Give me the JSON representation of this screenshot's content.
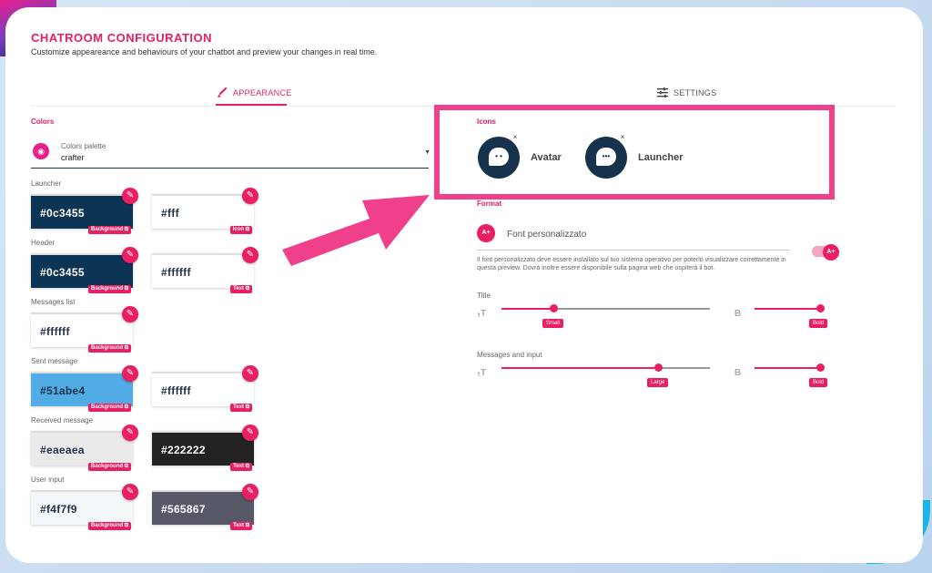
{
  "header": {
    "title": "CHATROOM CONFIGURATION",
    "subtitle": "Customize appeareance and behaviours of your chatbot and preview your changes in real time."
  },
  "tabs": [
    {
      "label": "APPEARANCE",
      "active": true
    },
    {
      "label": "SETTINGS",
      "active": false
    }
  ],
  "colors": {
    "section_label": "Colors",
    "palette": {
      "label": "Colors palette",
      "value": "crafter"
    },
    "groups": [
      {
        "label": "Launcher",
        "swatches": [
          {
            "hex": "#0c3455",
            "tag": "Background"
          },
          {
            "hex": "#fff",
            "tag": "Icon"
          }
        ]
      },
      {
        "label": "Header",
        "swatches": [
          {
            "hex": "#0c3455",
            "tag": "Background"
          },
          {
            "hex": "#ffffff",
            "tag": "Text"
          }
        ]
      },
      {
        "label": "Messages list",
        "swatches": [
          {
            "hex": "#ffffff",
            "tag": "Background"
          }
        ]
      },
      {
        "label": "Sent message",
        "swatches": [
          {
            "hex": "#51abe4",
            "tag": "Background"
          },
          {
            "hex": "#ffffff",
            "tag": "Text"
          }
        ]
      },
      {
        "label": "Received message",
        "swatches": [
          {
            "hex": "#eaeaea",
            "tag": "Background"
          },
          {
            "hex": "#222222",
            "tag": "Text"
          }
        ]
      },
      {
        "label": "User input",
        "swatches": [
          {
            "hex": "#f4f7f9",
            "tag": "Background"
          },
          {
            "hex": "#565867",
            "tag": "Text"
          }
        ]
      }
    ]
  },
  "icons": {
    "section_label": "Icons",
    "items": [
      {
        "label": "Avatar",
        "icon": "bot-face-icon"
      },
      {
        "label": "Launcher",
        "icon": "chat-dots-icon"
      }
    ]
  },
  "format": {
    "section_label": "Format",
    "custom_font": {
      "label": "Font personalizzato",
      "description": "Il font personalizzato deve essere installato sul tuo sistema operativo per poterlo visualizzare correttamente in questa preview. Dovrà inoltre essere disponibile sulla pagina web che ospiterà il bot.",
      "enabled": true
    },
    "title": {
      "label": "Title",
      "size": {
        "value": "Small",
        "level": 0.25
      },
      "weight": {
        "value": "Bold",
        "level": 1.0
      }
    },
    "messages": {
      "label": "Messages and input",
      "size": {
        "value": "Large",
        "level": 0.75
      },
      "weight": {
        "value": "Bold",
        "level": 1.0
      }
    }
  },
  "colors_accent": {
    "primary": "#e91e63",
    "navy": "#17324d",
    "highlight_box": "#f0408c",
    "arrow": "#f0408c"
  }
}
